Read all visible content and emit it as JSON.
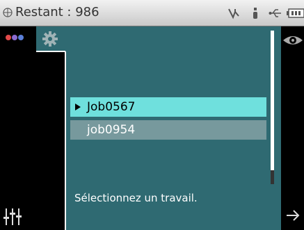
{
  "status": {
    "title": "Restant : 986",
    "icons": [
      "globe-icon",
      "vector-icon",
      "probe-icon",
      "usb-icon",
      "battery-icon"
    ]
  },
  "toolbar": {
    "dots_colors": [
      "#e24a4a",
      "#8b6cd1",
      "#5b7fd8"
    ],
    "settings_icon": "gear-icon",
    "adjust_icon": "sliders-icon"
  },
  "jobs": {
    "items": [
      {
        "label": "Job0567",
        "selected": true
      },
      {
        "label": "job0954",
        "selected": false
      }
    ]
  },
  "prompt": "Sélectionnez un travail.",
  "right": {
    "view_icon": "eye-icon",
    "next_icon": "arrow-right-icon"
  },
  "colors": {
    "panel": "#2f6a72",
    "selected": "#6fe0dd",
    "item": "#77999d"
  }
}
